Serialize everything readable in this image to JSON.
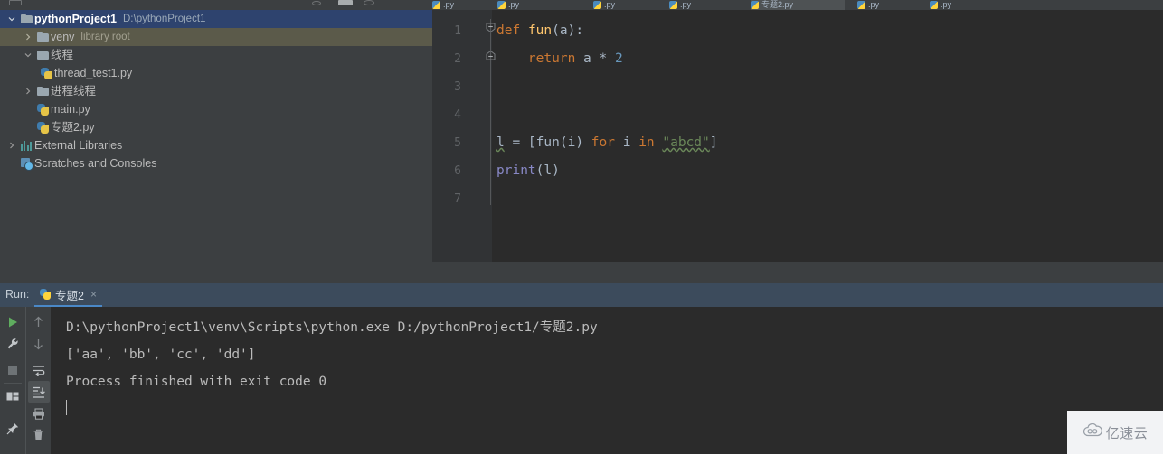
{
  "top_tabs": {
    "items": [
      {
        "label": ".py",
        "active": false
      },
      {
        "label": ".py",
        "active": false
      },
      {
        "label": ".py",
        "active": false
      },
      {
        "label": ".py",
        "active": false
      },
      {
        "label": "专题2.py",
        "active": true
      },
      {
        "label": ".py",
        "active": false
      },
      {
        "label": ".py",
        "active": false
      }
    ]
  },
  "sidebar": {
    "items": [
      {
        "name": "pythonProject1",
        "path": "D:\\pythonProject1",
        "arrow": "down",
        "icon": "folder-icon",
        "indent": 1,
        "state": "selected",
        "bold": true
      },
      {
        "name": "venv",
        "path": "library root",
        "arrow": "right",
        "icon": "folder-icon",
        "indent": 2,
        "state": "hover",
        "bold": false
      },
      {
        "name": "线程",
        "path": "",
        "arrow": "down",
        "icon": "folder-icon",
        "indent": 2,
        "state": "normal",
        "bold": false
      },
      {
        "name": "thread_test1.py",
        "path": "",
        "arrow": "none",
        "icon": "python-file-icon",
        "indent": 3,
        "state": "normal",
        "bold": false
      },
      {
        "name": "进程线程",
        "path": "",
        "arrow": "right",
        "icon": "folder-icon",
        "indent": 2,
        "state": "normal",
        "bold": false
      },
      {
        "name": "main.py",
        "path": "",
        "arrow": "none",
        "icon": "python-file-icon",
        "indent": 2,
        "state": "normal",
        "bold": false
      },
      {
        "name": "专题2.py",
        "path": "",
        "arrow": "none",
        "icon": "python-file-icon",
        "indent": 2,
        "state": "normal",
        "bold": false
      },
      {
        "name": "External Libraries",
        "path": "",
        "arrow": "right",
        "icon": "library-icon",
        "indent": 1,
        "state": "normal",
        "bold": false
      },
      {
        "name": "Scratches and Consoles",
        "path": "",
        "arrow": "none",
        "icon": "scratches-icon",
        "indent": 1,
        "state": "normal",
        "bold": false
      }
    ]
  },
  "editor": {
    "line_numbers": [
      "1",
      "2",
      "3",
      "4",
      "5",
      "6",
      "7"
    ],
    "lines": [
      {
        "n": 1,
        "tokens": [
          {
            "t": "def",
            "c": "k"
          },
          {
            "t": " ",
            "c": "id"
          },
          {
            "t": "fun",
            "c": "fn"
          },
          {
            "t": "(a):",
            "c": "id"
          }
        ]
      },
      {
        "n": 2,
        "tokens": [
          {
            "t": "    ",
            "c": "id"
          },
          {
            "t": "return",
            "c": "k"
          },
          {
            "t": " a ",
            "c": "id"
          },
          {
            "t": "*",
            "c": "id"
          },
          {
            "t": " ",
            "c": "id"
          },
          {
            "t": "2",
            "c": "num"
          }
        ]
      },
      {
        "n": 3,
        "tokens": []
      },
      {
        "n": 4,
        "tokens": []
      },
      {
        "n": 5,
        "tokens": [
          {
            "t": "l",
            "c": "id wavy-g"
          },
          {
            "t": " = [",
            "c": "id"
          },
          {
            "t": "fun",
            "c": "id"
          },
          {
            "t": "(i) ",
            "c": "id"
          },
          {
            "t": "for",
            "c": "k"
          },
          {
            "t": " i ",
            "c": "id"
          },
          {
            "t": "in",
            "c": "k"
          },
          {
            "t": " ",
            "c": "id"
          },
          {
            "t": "\"abcd\"",
            "c": "str wavy-g"
          },
          {
            "t": "]",
            "c": "id"
          }
        ]
      },
      {
        "n": 6,
        "tokens": [
          {
            "t": "print",
            "c": "bi"
          },
          {
            "t": "(l)",
            "c": "id"
          }
        ]
      },
      {
        "n": 7,
        "tokens": []
      }
    ]
  },
  "run_panel": {
    "label": "Run:",
    "tab_title": "专题2",
    "close_glyph": "×",
    "left_tools": [
      {
        "name": "rerun-button",
        "icon": "play-icon"
      },
      {
        "name": "settings-button",
        "icon": "wrench-icon"
      },
      {
        "name": "stop-button",
        "icon": "stop-icon"
      },
      {
        "name": "layout-button",
        "icon": "layout-icon"
      },
      {
        "name": "pin-button",
        "icon": "pin-icon"
      }
    ],
    "right_tools": [
      {
        "name": "scroll-up-button",
        "icon": "arrow-up-icon",
        "active": false
      },
      {
        "name": "scroll-down-button",
        "icon": "arrow-down-icon",
        "active": false
      },
      {
        "name": "soft-wrap-button",
        "icon": "soft-wrap-icon",
        "active": false
      },
      {
        "name": "scroll-to-end-button",
        "icon": "scroll-to-end-icon",
        "active": true
      },
      {
        "name": "print-button",
        "icon": "printer-icon",
        "active": false
      },
      {
        "name": "clear-all-button",
        "icon": "trash-icon",
        "active": false
      }
    ],
    "output": [
      "D:\\pythonProject1\\venv\\Scripts\\python.exe D:/pythonProject1/专题2.py",
      "['aa', 'bb', 'cc', 'dd']",
      "",
      "Process finished with exit code 0"
    ]
  },
  "watermark": {
    "text": "亿速云",
    "icon": "cloud-logo-icon"
  },
  "colors": {
    "panel_bg": "#3c3f41",
    "editor_bg": "#2b2b2b",
    "gutter_bg": "#313335",
    "tree_selected": "#2e436e",
    "tree_hover": "#5b5a4a",
    "run_bar_bg": "#3c4b5c",
    "tab_underline": "#4a88c7",
    "keyword": "#cc7832",
    "function": "#ffc66d",
    "string": "#6a8759",
    "number": "#6897bb",
    "builtin": "#8888c6",
    "text": "#a9b7c6"
  }
}
